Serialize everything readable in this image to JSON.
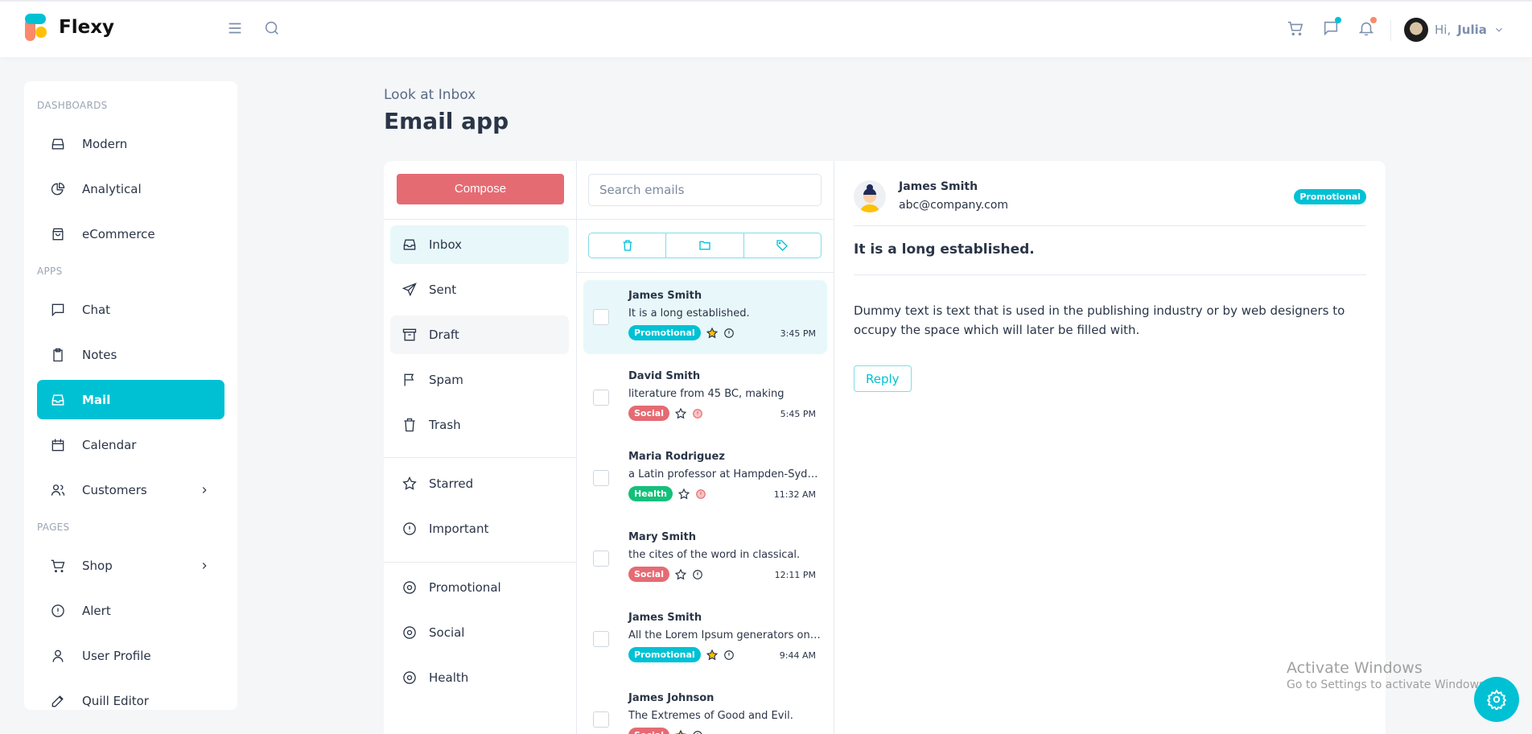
{
  "app": {
    "name": "Flexy",
    "greeting": "Hi,",
    "user": "Julia"
  },
  "colors": {
    "accent": "#00c1d4",
    "compose": "#e56b73",
    "promotional": "#00c1d4",
    "social": "#e56b73",
    "health": "#13c07a",
    "msg_dot": "#00c1d4",
    "bell_dot": "#fa896b"
  },
  "sidebar": {
    "sections": [
      "DASHBOARDS",
      "APPS",
      "PAGES"
    ],
    "items": [
      {
        "label": "Modern",
        "icon": "inbox-icon"
      },
      {
        "label": "Analytical",
        "icon": "chart-pie-icon"
      },
      {
        "label": "eCommerce",
        "icon": "shopping-bag-icon"
      },
      {
        "label": "Chat",
        "icon": "message-icon"
      },
      {
        "label": "Notes",
        "icon": "clipboard-icon"
      },
      {
        "label": "Mail",
        "icon": "mail-icon",
        "active": true
      },
      {
        "label": "Calendar",
        "icon": "calendar-icon"
      },
      {
        "label": "Customers",
        "icon": "users-icon"
      },
      {
        "label": "Shop",
        "icon": "cart-icon"
      },
      {
        "label": "Alert",
        "icon": "alert-icon"
      },
      {
        "label": "User Profile",
        "icon": "user-icon"
      },
      {
        "label": "Quill Editor",
        "icon": "edit-icon"
      }
    ]
  },
  "page": {
    "subtitle": "Look at Inbox",
    "title": "Email app"
  },
  "folders": {
    "compose": "Compose",
    "items": [
      "Inbox",
      "Sent",
      "Draft",
      "Spam",
      "Trash"
    ],
    "flags": [
      "Starred",
      "Important"
    ],
    "labels": [
      "Promotional",
      "Social",
      "Health"
    ]
  },
  "list": {
    "search_placeholder": "Search emails",
    "emails": [
      {
        "from": "James Smith",
        "subject": "It is a long established.",
        "label": "Promotional",
        "starred": true,
        "important": false,
        "time": "3:45 PM"
      },
      {
        "from": "David Smith",
        "subject": "literature from 45 BC, making",
        "label": "Social",
        "starred": false,
        "important": true,
        "time": "5:45 PM"
      },
      {
        "from": "Maria Rodriguez",
        "subject": "a Latin professor at Hampden-Sydney College",
        "label": "Health",
        "starred": false,
        "important": true,
        "time": "11:32 AM"
      },
      {
        "from": "Mary Smith",
        "subject": "the cites of the word in classical.",
        "label": "Social",
        "starred": false,
        "important": false,
        "time": "12:11 PM"
      },
      {
        "from": "James Smith",
        "subject": "All the Lorem Ipsum generators on the Internet",
        "label": "Promotional",
        "starred": true,
        "important": false,
        "time": "9:44 AM"
      },
      {
        "from": "James Johnson",
        "subject": "The Extremes of Good and Evil.",
        "label": "Social",
        "starred": true,
        "important": false,
        "time": ""
      }
    ]
  },
  "reader": {
    "from": "James Smith",
    "email": "abc@company.com",
    "label": "Promotional",
    "subject": "It is a long established.",
    "body": "Dummy text is text that is used in the publishing industry or by web designers to occupy the space which will later be filled with.",
    "reply": "Reply"
  },
  "watermark": {
    "title": "Activate Windows",
    "subtitle": "Go to Settings to activate Windows."
  }
}
